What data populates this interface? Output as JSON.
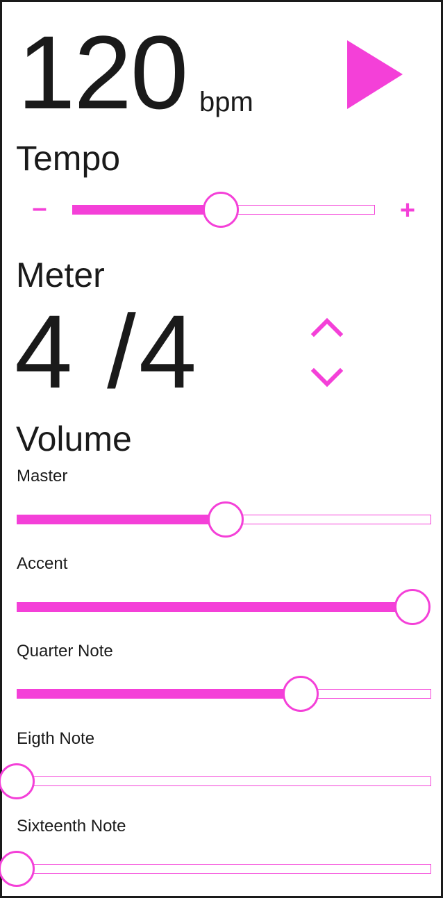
{
  "colors": {
    "accent": "#f440d8",
    "text": "#1a1a1a",
    "background": "#ffffff"
  },
  "tempo_display": {
    "value": "120",
    "unit": "bpm"
  },
  "play_button": {
    "icon": "play-icon"
  },
  "tempo": {
    "title": "Tempo",
    "minus_label": "–",
    "plus_label": "+",
    "level": 0.49
  },
  "meter": {
    "title": "Meter",
    "value": "4 /4",
    "up_icon": "chevron-up-icon",
    "down_icon": "chevron-down-icon"
  },
  "volume": {
    "title": "Volume",
    "channels": [
      {
        "label": "Master",
        "level": 0.505
      },
      {
        "label": "Accent",
        "level": 1.0
      },
      {
        "label": "Quarter Note",
        "level": 0.685
      },
      {
        "label": "Eigth Note",
        "level": 0.0
      },
      {
        "label": "Sixteenth Note",
        "level": 0.0
      }
    ]
  }
}
